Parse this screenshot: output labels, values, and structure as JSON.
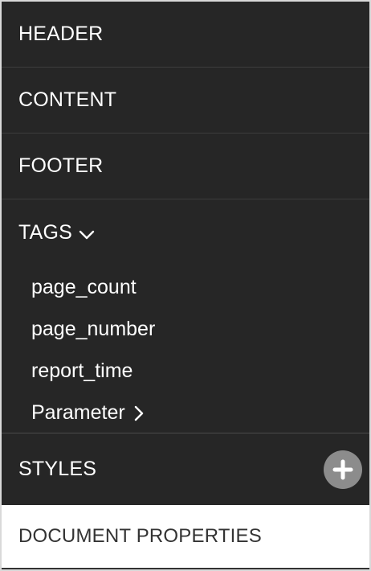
{
  "sections": {
    "header": "HEADER",
    "content": "CONTENT",
    "footer": "FOOTER",
    "tags": {
      "label": "TAGS",
      "expanded": true,
      "items": [
        "page_count",
        "page_number",
        "report_time",
        "Parameter"
      ]
    },
    "styles": "STYLES",
    "document_properties": "DOCUMENT PROPERTIES"
  },
  "colors": {
    "panel_bg": "#262626",
    "divider": "#3d3d3d",
    "add_button_bg": "#8c8c8c",
    "doc_props_bg": "#ffffff",
    "doc_props_text": "#333333"
  },
  "icons": {
    "tags_toggle": "chevron-down-icon",
    "parameter_expand": "chevron-right-icon",
    "add_style": "plus-icon"
  }
}
